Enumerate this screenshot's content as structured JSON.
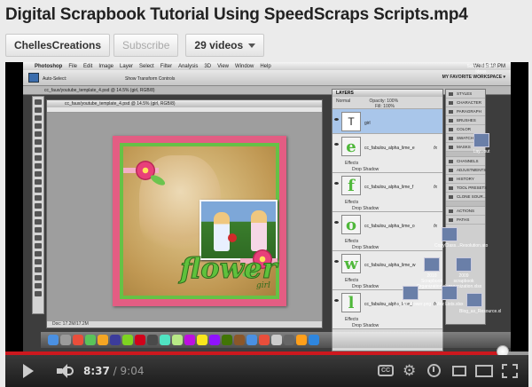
{
  "video": {
    "title": "Digital Scrapbook Tutorial Using SpeedScraps Scripts.mp4"
  },
  "channel": {
    "name": "ChellesCreations",
    "subscribe_label": "Subscribe",
    "videos_label": "29 videos"
  },
  "screen": {
    "menu": [
      "Photoshop",
      "File",
      "Edit",
      "Image",
      "Layer",
      "Select",
      "Filter",
      "Analysis",
      "3D",
      "View",
      "Window",
      "Help"
    ],
    "clock": "Wed 5:18 PM",
    "workspace_label": "MY FAVORITE WORKSPACE ▾",
    "options_auto_select": "Auto-Select:",
    "options_show_transform": "Show Transform Controls",
    "document_tab": "cc_faux/youtube_template_4.psd @ 14.5% (girl, RGB/8)",
    "doc_status": "Doc: 17.2M/17.2M",
    "scrap_word": "flower",
    "scrap_sub": "girl",
    "layers_panel": {
      "title": "LAYERS",
      "blend_mode": "Normal",
      "opacity": "Opacity: 100%",
      "fill": "Fill: 100%",
      "layers": [
        {
          "name": "girl",
          "thumb": "T",
          "selected": true
        },
        {
          "name": "cc_fabulou_alpha_lime_e",
          "thumb": "e",
          "effect": "Drop Shadow"
        },
        {
          "name": "cc_fabulou_alpha_lime_f",
          "thumb": "f",
          "effect": "Drop Shadow"
        },
        {
          "name": "cc_fabulou_alpha_lime_o",
          "thumb": "o",
          "effect": "Drop Shadow"
        },
        {
          "name": "cc_fabulou_alpha_lime_w",
          "thumb": "w",
          "effect": "Drop Shadow"
        },
        {
          "name": "cc_fabulou_alpha_lime_l",
          "thumb": "l",
          "effect": "Drop Shadow"
        }
      ],
      "effects_label": "Effects"
    },
    "dock_panels": [
      "STYLES",
      "CHARACTER",
      "PARAGRAPH",
      "BRUSHES",
      "COLOR",
      "SWATCHES",
      "MASKS",
      "CHANNELS",
      "ADJUSTMENTS",
      "HISTORY",
      "TOOL PRESETS",
      "CLONE SOUR...",
      "ACTIONS",
      "PATHS"
    ],
    "desktop_icons": [
      {
        "label": "Succ...Building Ideas.",
        "x": 0,
        "y": 0
      },
      {
        "label": "Lay...out",
        "x": 0,
        "y": 0
      },
      {
        "label": "CopyClass...Resolution.ato",
        "x": 0,
        "y": 0
      },
      {
        "label": "2010 Scrapbook Organization.xlsx",
        "x": 0,
        "y": 0
      },
      {
        "label": "2009 scrapbook organization.xlsx",
        "x": 0,
        "y": 0
      },
      {
        "label": "Mez Lists.xlsx",
        "x": 0,
        "y": 0
      },
      {
        "label": "Blog_as_Resource.xl",
        "x": 0,
        "y": 0
      },
      {
        "label": "cc_ffo...flower.png",
        "x": 0,
        "y": 0
      }
    ]
  },
  "player": {
    "current_time": "8:37",
    "separator": " / ",
    "duration": "9:04",
    "progress_fraction": 0.9504,
    "buffered_fraction": 1.0
  }
}
